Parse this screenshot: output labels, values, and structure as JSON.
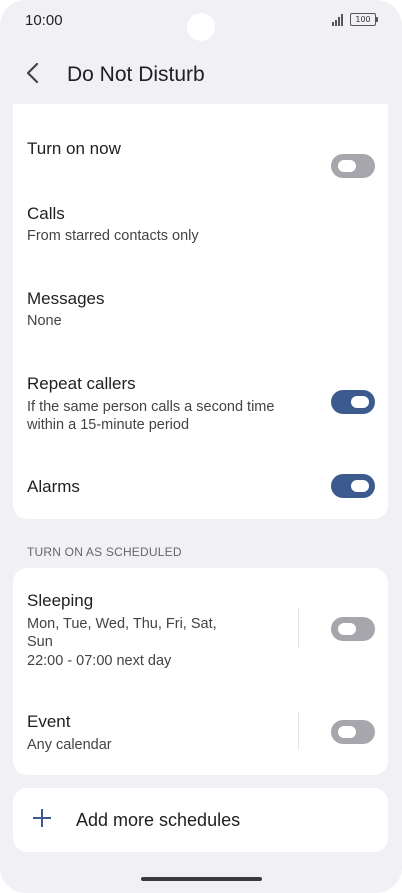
{
  "status_bar": {
    "time": "10:00",
    "battery": "100"
  },
  "header": {
    "title": "Do Not Disturb"
  },
  "settings": [
    {
      "label": "Turn on now",
      "toggle": false
    },
    {
      "label": "Calls",
      "sub": "From starred contacts only"
    },
    {
      "label": "Messages",
      "sub": "None"
    },
    {
      "label": "Repeat callers",
      "sub_line1": "If the same person calls a second time",
      "sub_line2": "within a 15-minute period",
      "toggle": true
    },
    {
      "label": "Alarms",
      "toggle": true
    }
  ],
  "section_heading": "TURN ON AS SCHEDULED",
  "schedules": [
    {
      "label": "Sleeping",
      "days_line1": "Mon, Tue, Wed, Thu, Fri, Sat,",
      "days_line2": "Sun",
      "time": "22:00 - 07:00 next day",
      "toggle": false
    },
    {
      "label": "Event",
      "sub": "Any calendar",
      "toggle": false
    }
  ],
  "add_schedule": {
    "label": "Add more schedules"
  },
  "colors": {
    "accent": "#3d5a8f",
    "toggle_off": "#a6a6ac",
    "background": "#f1f1f5"
  },
  "icons": {
    "back": "chevron-left-icon",
    "add": "plus-icon"
  }
}
